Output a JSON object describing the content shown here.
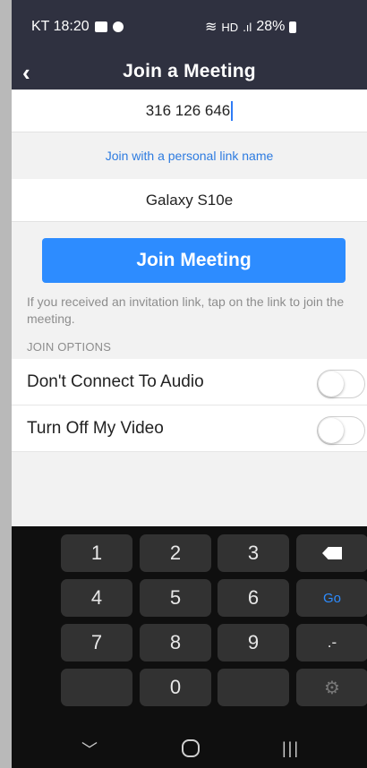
{
  "status_bar": {
    "carrier_time": "KT 18:20",
    "battery": "28%",
    "hd_label": "HD"
  },
  "header": {
    "back_glyph": "‹",
    "title": "Join a Meeting"
  },
  "meeting_id": {
    "value": "316 126 646"
  },
  "personal_link": {
    "label": "Join with a personal link name"
  },
  "display_name": {
    "value": "Galaxy S10e"
  },
  "join_button": {
    "label": "Join Meeting"
  },
  "hint": {
    "text": "If you received an invitation link, tap on the link to join the meeting."
  },
  "join_options": {
    "section_label": "JOIN OPTIONS",
    "items": [
      {
        "label": "Don't Connect To Audio",
        "enabled": false
      },
      {
        "label": "Turn Off My Video",
        "enabled": false
      }
    ]
  },
  "keyboard": {
    "keys": [
      "1",
      "2",
      "3",
      "4",
      "5",
      "6",
      "7",
      "8",
      "9",
      "0"
    ],
    "go_label": "Go",
    "dot_dash_label": ".-"
  },
  "colors": {
    "header_bg": "#2f3140",
    "accent": "#2d8cff",
    "link": "#2d7be0",
    "keyboard_bg": "#0f0f0f"
  }
}
